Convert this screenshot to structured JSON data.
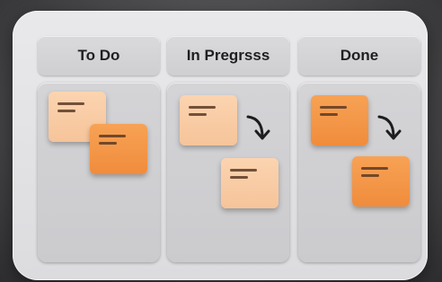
{
  "board": {
    "columns": [
      {
        "id": "todo",
        "title": "To Do",
        "cards": [
          {
            "shade": "light"
          },
          {
            "shade": "dark"
          }
        ]
      },
      {
        "id": "in-progress",
        "title": "In Pregrsss",
        "cards": [
          {
            "shade": "light"
          },
          {
            "shade": "light"
          }
        ]
      },
      {
        "id": "done",
        "title": "Done",
        "cards": [
          {
            "shade": "dark"
          },
          {
            "shade": "dark"
          }
        ]
      }
    ]
  },
  "colors": {
    "card_light": "#f9cea8",
    "card_dark": "#f39648",
    "column_bg": "#d0d0d3",
    "text_line": "#5a3a25"
  },
  "icons": {
    "move_arrow": "curved-arrow-down-icon"
  }
}
